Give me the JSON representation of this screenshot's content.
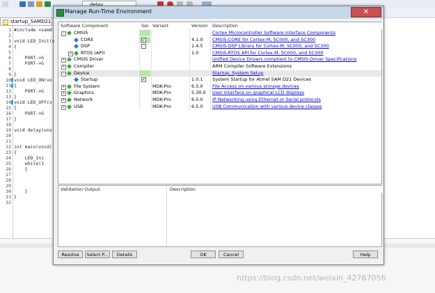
{
  "ide": {
    "toolbar_combo": "delay",
    "tab_label": "startup_SAMD21.c",
    "lines": [
      {
        "n": "1",
        "code": "#include <samd"
      },
      {
        "n": "2",
        "code": ""
      },
      {
        "n": "3",
        "code": "void LED_Init(v"
      },
      {
        "n": "4",
        "code": "{"
      },
      {
        "n": "5",
        "code": ""
      },
      {
        "n": "6",
        "code": "    PORT->G"
      },
      {
        "n": "7",
        "code": "    PORT->G"
      },
      {
        "n": "8",
        "code": ""
      },
      {
        "n": "9",
        "code": "}"
      },
      {
        "n": "10",
        "code": "void LED_ON(vo"
      },
      {
        "n": "11",
        "code": "{"
      },
      {
        "n": "12",
        "code": "    PORT->G"
      },
      {
        "n": "13",
        "code": "}"
      },
      {
        "n": "14",
        "code": "void LED_OFF(v"
      },
      {
        "n": "15",
        "code": "{"
      },
      {
        "n": "16",
        "code": "    PORT->G"
      },
      {
        "n": "17",
        "code": "}"
      },
      {
        "n": "18",
        "code": ""
      },
      {
        "n": "19",
        "code": "void delay(uns"
      },
      {
        "n": "20",
        "code": ""
      },
      {
        "n": "21",
        "code": ""
      },
      {
        "n": "22",
        "code": "int main(void)"
      },
      {
        "n": "23",
        "code": "{"
      },
      {
        "n": "24",
        "code": "    LED_Ini"
      },
      {
        "n": "25",
        "code": "    while(1"
      },
      {
        "n": "26",
        "code": "    {"
      },
      {
        "n": "27",
        "code": ""
      },
      {
        "n": "28",
        "code": ""
      },
      {
        "n": "29",
        "code": ""
      },
      {
        "n": "30",
        "code": "    }"
      },
      {
        "n": "31",
        "code": "}"
      },
      {
        "n": "32",
        "code": ""
      }
    ]
  },
  "dialog": {
    "title": "Manage Run-Time Environment",
    "close_glyph": "✕",
    "columns": {
      "component": "Software Component",
      "sel": "Sel.",
      "variant": "Variant",
      "version": "Version",
      "description": "Description"
    },
    "rows": [
      {
        "label": "CMSIS",
        "sel": "",
        "variant": "",
        "version": "",
        "desc": "Cortex Microcontroller Software Interface Components",
        "link": true
      },
      {
        "label": "CORE",
        "sel": "✓",
        "variant": "",
        "version": "4.1.0",
        "desc": "CMSIS-CORE for Cortex-M, SC000, and SC300",
        "link": true
      },
      {
        "label": "DSP",
        "sel": "",
        "variant": "",
        "version": "1.4.5",
        "desc": "CMSIS-DSP Library for Cortex-M, SC000, and SC300",
        "link": true
      },
      {
        "label": "RTOS (API)",
        "sel": "",
        "variant": "",
        "version": "1.0",
        "desc": "CMSIS-RTOS API for Cortex-M, SC000, and SC300",
        "link": true
      },
      {
        "label": "CMSIS Driver",
        "sel": "",
        "variant": "",
        "version": "",
        "desc": "Unified Device Drivers compliant to CMSIS-Driver Specifications",
        "link": true
      },
      {
        "label": "Compiler",
        "sel": "",
        "variant": "",
        "version": "",
        "desc": "ARM Compiler Software Extensions",
        "link": false
      },
      {
        "label": "Device",
        "sel": "",
        "variant": "",
        "version": "",
        "desc": "Startup, System Setup",
        "link": true
      },
      {
        "label": "Startup",
        "sel": "✓",
        "variant": "",
        "version": "1.0.1",
        "desc": "System Startup for Atmel SAM D21 Devices",
        "link": false
      },
      {
        "label": "File System",
        "sel": "",
        "variant": "MDK-Pro",
        "version": "6.5.0",
        "desc": "File Access on various storage devices",
        "link": true
      },
      {
        "label": "Graphics",
        "sel": "",
        "variant": "MDK-Pro",
        "version": "5.30.0",
        "desc": "User Interface on graphical LCD displays",
        "link": true
      },
      {
        "label": "Network",
        "sel": "",
        "variant": "MDK-Pro",
        "version": "6.5.0",
        "desc": "IP Networking using Ethernet or Serial protocols",
        "link": true
      },
      {
        "label": "USB",
        "sel": "",
        "variant": "MDK-Pro",
        "version": "6.5.0",
        "desc": "USB Communication with various device classes",
        "link": true
      }
    ],
    "validation": {
      "output": "Validation Output",
      "description": "Description"
    },
    "buttons": {
      "resolve": "Resolve",
      "select": "Select P...",
      "details": "Details",
      "ok": "OK",
      "cancel": "Cancel",
      "help": "Help"
    }
  },
  "watermark": "https://blog.csdn.net/weixin_42767056"
}
